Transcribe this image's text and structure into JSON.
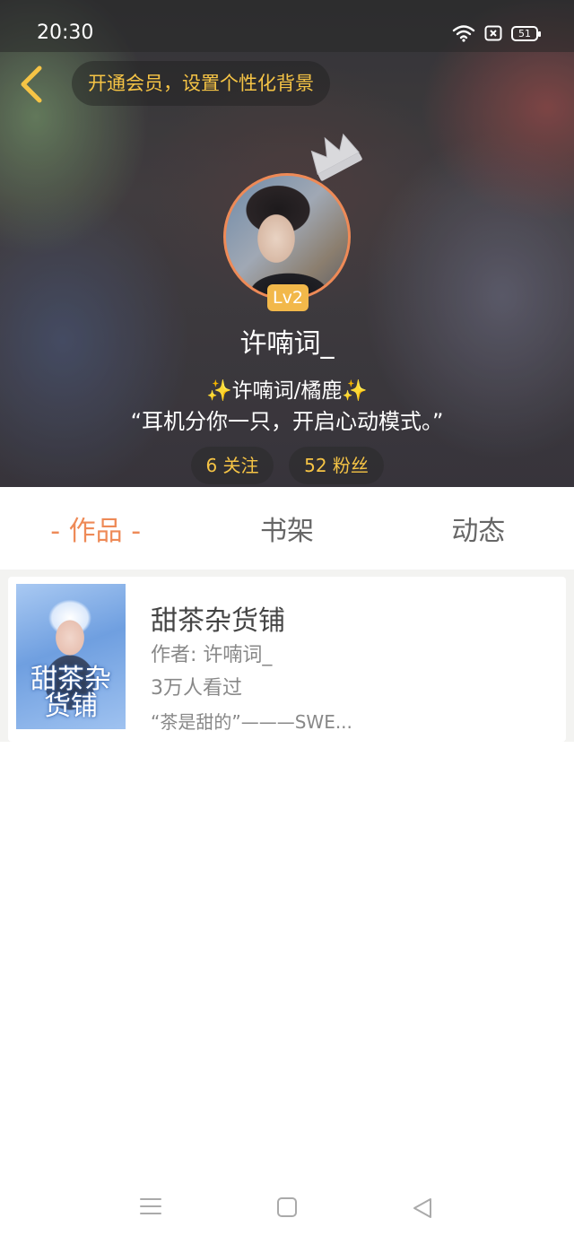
{
  "status_bar": {
    "time": "20:30",
    "battery": "51"
  },
  "header": {
    "vip_banner": "开通会员，设置个性化背景",
    "level": "Lv2",
    "username": "许喃词_",
    "signature_line1": "许喃词/橘鹿",
    "signature_line1_sparkle": "✨",
    "signature_line2": "“耳机分你一只，开启心动模式。”",
    "following": "6 关注",
    "followers": "52 粉丝"
  },
  "tabs": [
    {
      "label": "- 作品 -",
      "active": true
    },
    {
      "label": "书架",
      "active": false
    },
    {
      "label": "动态",
      "active": false
    }
  ],
  "works": [
    {
      "title": "甜茶杂货铺",
      "author": "作者: 许喃词_",
      "views": "3万人看过",
      "description": "“茶是甜的”———SWE...",
      "cover_text": "甜茶杂货铺"
    }
  ],
  "colors": {
    "accent": "#ee8a57",
    "vip_gold": "#f6c445",
    "level_badge": "#f2b84a"
  },
  "icons": {
    "back": "chevron-left-icon",
    "crown": "crown-icon",
    "wifi": "wifi-icon",
    "sim": "sim-icon",
    "battery": "battery-icon",
    "nav_menu": "menu-icon",
    "nav_home": "home-square-icon",
    "nav_back": "back-triangle-icon"
  }
}
